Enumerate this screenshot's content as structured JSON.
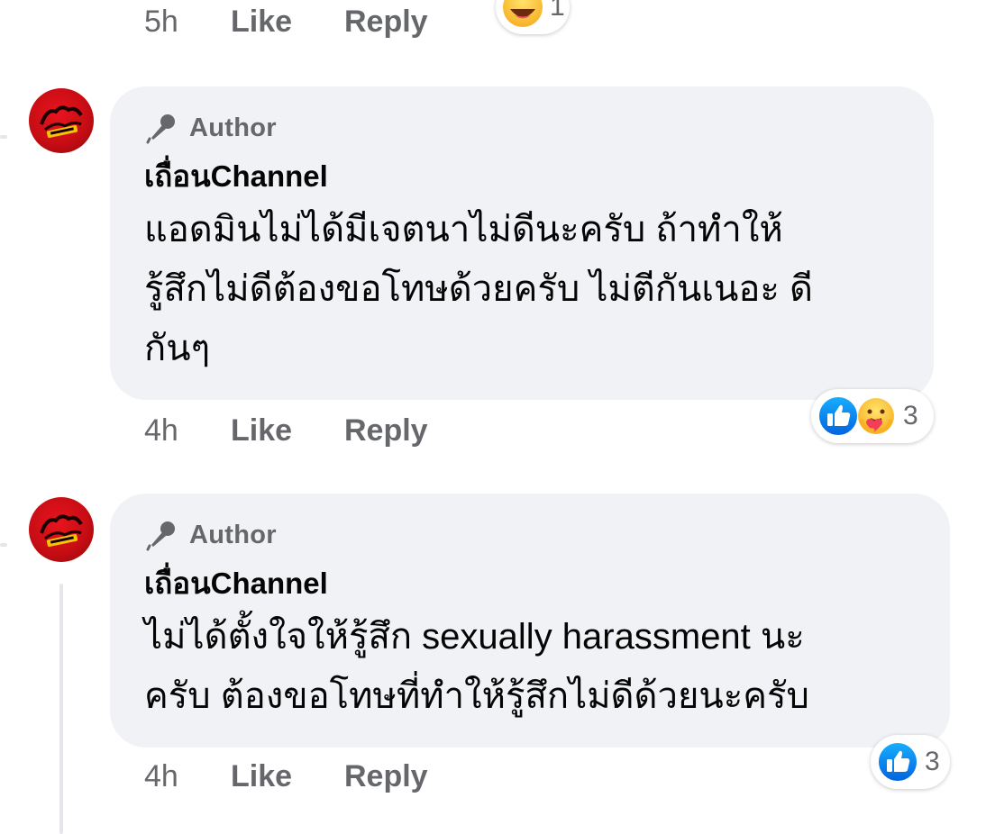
{
  "top_comment": {
    "time": "5h",
    "like_label": "Like",
    "reply_label": "Reply",
    "reaction_count": "1",
    "reactions": [
      "haha-icon"
    ]
  },
  "comments": [
    {
      "author_badge": "Author",
      "name": "เถื่อนChannel",
      "text_lines": [
        "แอดมินไม่ได้มีเจตนาไม่ดีนะครับ ถ้าทำให้",
        "รู้สึกไม่ดีต้องขอโทษด้วยครับ ไม่ตีกันเนอะ ดี",
        "กันๆ"
      ],
      "time": "4h",
      "like_label": "Like",
      "reply_label": "Reply",
      "reaction_count": "3",
      "reactions": [
        "like-icon",
        "care-icon"
      ]
    },
    {
      "author_badge": "Author",
      "name": "เถื่อนChannel",
      "text_lines": [
        "ไม่ได้ตั้งใจให้รู้สึก sexually harassment นะ",
        "ครับ ต้องขอโทษที่ทำให้รู้สึกไม่ดีด้วยนะครับ"
      ],
      "time": "4h",
      "like_label": "Like",
      "reply_label": "Reply",
      "reaction_count": "3",
      "reactions": [
        "like-icon"
      ]
    }
  ],
  "colors": {
    "bubble": "#f0f2f5",
    "meta_text": "#65676b",
    "like_blue": "#1877f2",
    "avatar_red": "#d40f16"
  }
}
